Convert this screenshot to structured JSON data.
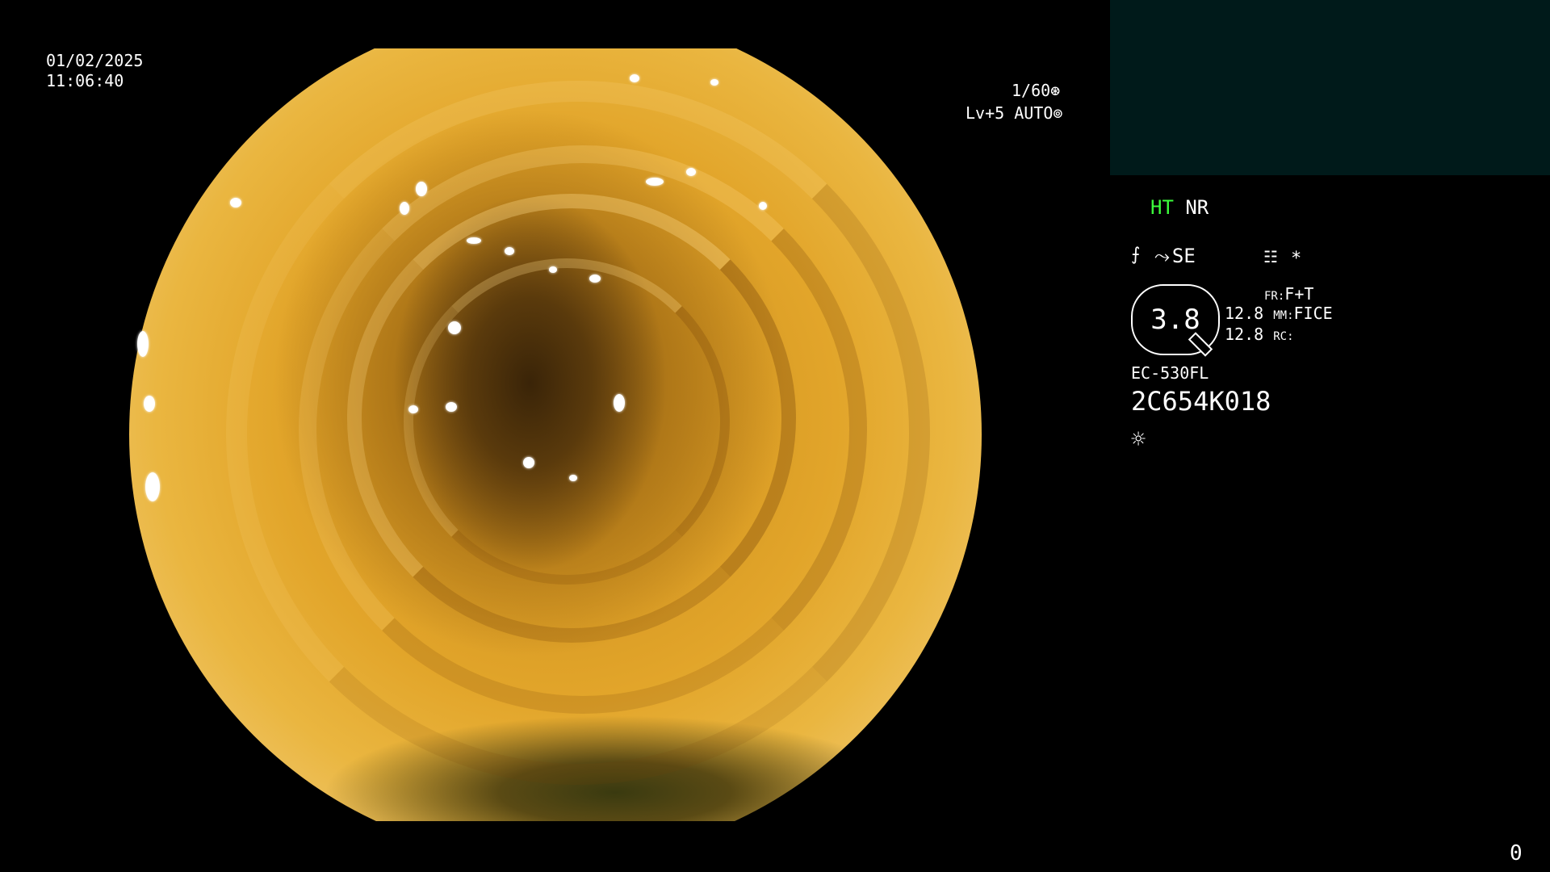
{
  "datetime": {
    "date": "01/02/2025",
    "time": "11:06:40"
  },
  "exposure": {
    "shutter": "1/60",
    "shutter_icon": "⊛",
    "level": "Lv+5",
    "mode": "AUTO",
    "mode_icon": "⊚"
  },
  "enhancement": {
    "ht": "HT",
    "nr": "NR",
    "se": "SE",
    "se_icon": "scope-angle-icon",
    "curve_icon": "curve-icon",
    "menu_icon": "☷",
    "star": "*"
  },
  "magnification": {
    "dial_value": "3.8",
    "row1_value": "12.8",
    "row1_key": "MM:",
    "row1_mode": "FICE",
    "row2_value": "12.8",
    "row2_key": "RC:",
    "fr_key": "FR:",
    "fr_value": "F+T"
  },
  "scope": {
    "model": "EC-530FL",
    "serial": "2C654K018",
    "light_icon": "☼"
  },
  "counter": "0",
  "colors": {
    "accent_green": "#3cff3c",
    "panel_teal": "#001a1a",
    "text": "#ffffff"
  }
}
